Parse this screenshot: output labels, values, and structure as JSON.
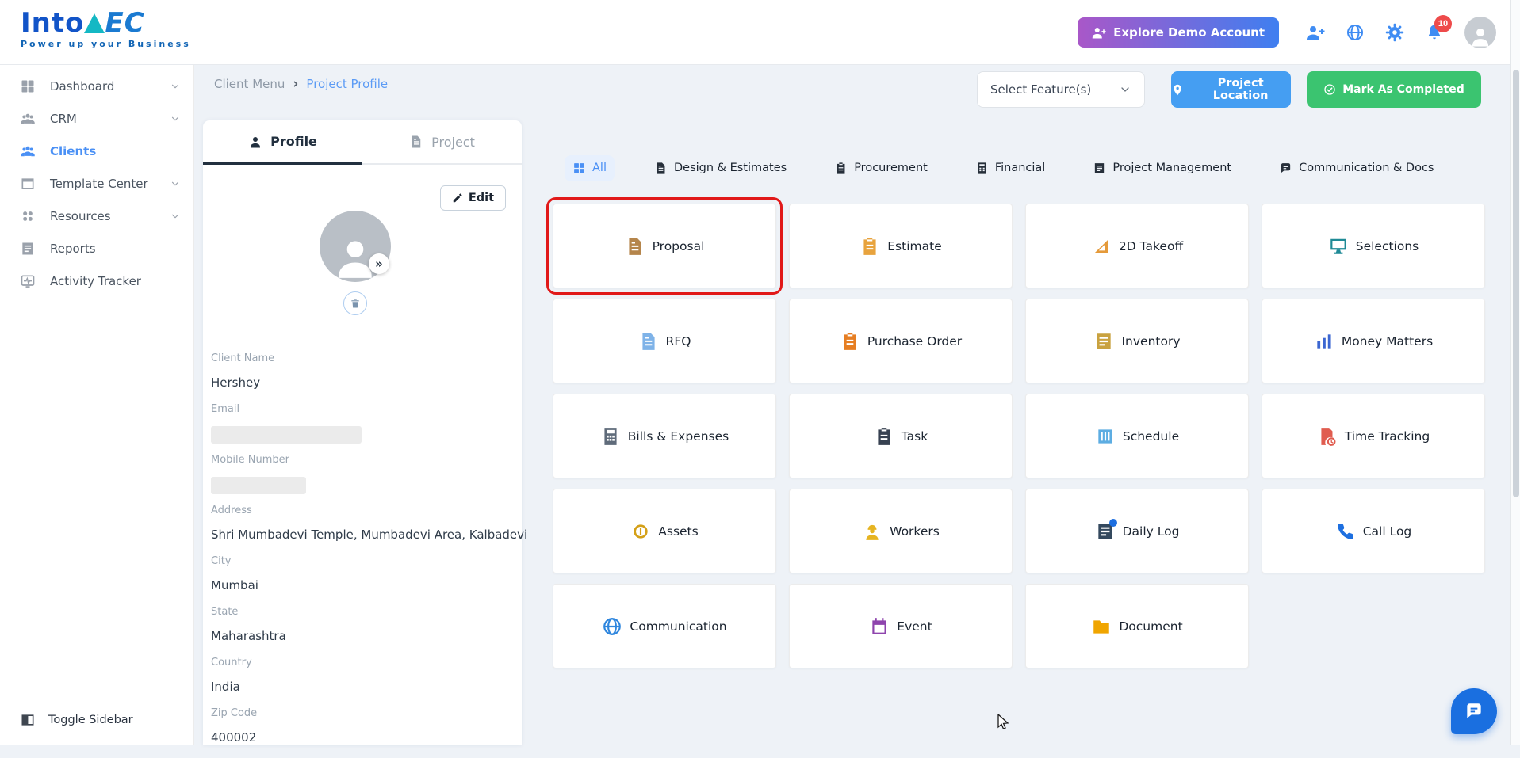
{
  "brand": {
    "logo_into": "Into",
    "logo_a": "A",
    "logo_ec": "EC",
    "tagline": "Power up your Business"
  },
  "header": {
    "explore_button_label": "Explore Demo Account",
    "notification_count": "10",
    "icons": [
      "user-add-icon",
      "globe-icon",
      "gear-icon",
      "bell-icon",
      "user-avatar"
    ]
  },
  "sidebar": {
    "items": [
      {
        "label": "Dashboard",
        "icon": "dashboard-grid-icon",
        "expandable": true
      },
      {
        "label": "CRM",
        "icon": "crm-people-icon",
        "expandable": true
      },
      {
        "label": "Clients",
        "icon": "clients-people-icon",
        "active": true
      },
      {
        "label": "Template Center",
        "icon": "template-window-icon",
        "expandable": true
      },
      {
        "label": "Resources",
        "icon": "resources-nodes-icon",
        "expandable": true
      },
      {
        "label": "Reports",
        "icon": "reports-doc-icon"
      },
      {
        "label": "Activity Tracker",
        "icon": "activity-pulse-icon"
      }
    ],
    "toggle_label": "Toggle Sidebar"
  },
  "breadcrumb": {
    "parent": "Client Menu",
    "separator": "›",
    "current": "Project Profile"
  },
  "toolbar": {
    "feature_select_label": "Select Feature(s)",
    "project_location_label": "Project Location",
    "mark_completed_label": "Mark As Completed"
  },
  "profile_panel": {
    "tab_profile": "Profile",
    "tab_project": "Project",
    "edit_label": "Edit",
    "expand_badge": "»",
    "fields": [
      {
        "label": "Client Name",
        "value": "Hershey"
      },
      {
        "label": "Email",
        "value": "",
        "redacted": true
      },
      {
        "label": "Mobile Number",
        "value": "",
        "redacted": true
      },
      {
        "label": "Address",
        "value": "Shri Mumbadevi Temple, Mumbadevi Area, Kalbadevi"
      },
      {
        "label": "City",
        "value": "Mumbai"
      },
      {
        "label": "State",
        "value": "Maharashtra"
      },
      {
        "label": "Country",
        "value": "India"
      },
      {
        "label": "Zip Code",
        "value": "400002"
      }
    ]
  },
  "feature_tabs": [
    {
      "label": "All",
      "icon": "all-grid-icon",
      "active": true
    },
    {
      "label": "Design & Estimates",
      "icon": "design-estimates-icon"
    },
    {
      "label": "Procurement",
      "icon": "procurement-icon"
    },
    {
      "label": "Financial",
      "icon": "financial-icon"
    },
    {
      "label": "Project Management",
      "icon": "project-management-icon"
    },
    {
      "label": "Communication & Docs",
      "icon": "communication-docs-icon"
    }
  ],
  "feature_cards": [
    {
      "label": "Proposal",
      "icon": "proposal-icon",
      "highlighted": true
    },
    {
      "label": "Estimate",
      "icon": "estimate-icon"
    },
    {
      "label": "2D Takeoff",
      "icon": "takeoff-icon"
    },
    {
      "label": "Selections",
      "icon": "selections-icon"
    },
    {
      "label": "RFQ",
      "icon": "rfq-icon"
    },
    {
      "label": "Purchase Order",
      "icon": "purchase-order-icon"
    },
    {
      "label": "Inventory",
      "icon": "inventory-icon"
    },
    {
      "label": "Money Matters",
      "icon": "money-matters-icon"
    },
    {
      "label": "Bills & Expenses",
      "icon": "bills-expenses-icon"
    },
    {
      "label": "Task",
      "icon": "task-icon"
    },
    {
      "label": "Schedule",
      "icon": "schedule-icon"
    },
    {
      "label": "Time Tracking",
      "icon": "time-tracking-icon"
    },
    {
      "label": "Assets",
      "icon": "assets-icon"
    },
    {
      "label": "Workers",
      "icon": "workers-icon"
    },
    {
      "label": "Daily Log",
      "icon": "daily-log-icon"
    },
    {
      "label": "Call Log",
      "icon": "call-log-icon"
    },
    {
      "label": "Communication",
      "icon": "communication-icon"
    },
    {
      "label": "Event",
      "icon": "event-icon"
    },
    {
      "label": "Document",
      "icon": "document-icon"
    }
  ],
  "colors": {
    "accent_blue": "#459ef2",
    "breadcrumb_blue": "#5b9bf5",
    "success_green": "#3bc470",
    "highlight_red": "#e11919",
    "badge_red": "#ee4b4b",
    "gradient_start": "#a957c8",
    "gradient_end": "#3f7ff0",
    "chat_blue": "#1a6fe0"
  }
}
